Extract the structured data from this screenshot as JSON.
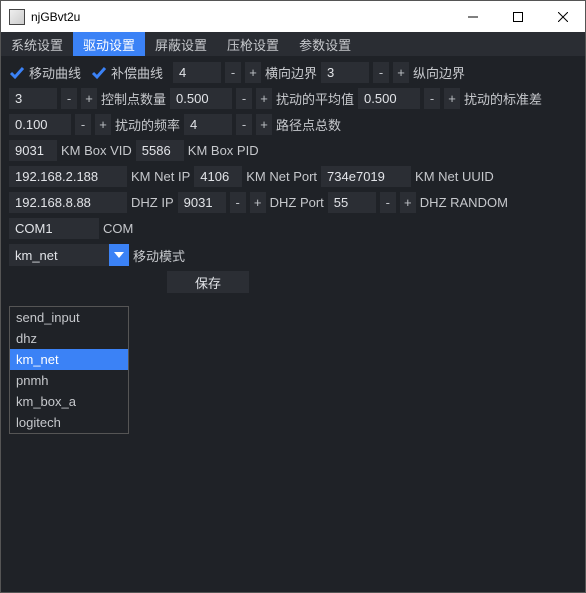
{
  "window": {
    "title": "njGBvt2u",
    "minimize": "–",
    "maximize": "□",
    "close": "×"
  },
  "tabs": {
    "system": "系统设置",
    "driver": "驱动设置",
    "shield": "屏蔽设置",
    "press": "压枪设置",
    "param": "参数设置"
  },
  "checks": {
    "move_curve": "移动曲线",
    "comp_curve": "补偿曲线"
  },
  "labels": {
    "h_border": "横向边界",
    "v_border": "纵向边界",
    "ctrl_points": "控制点数量",
    "perturb_mean": "扰动的平均值",
    "perturb_std": "扰动的标准差",
    "perturb_freq": "扰动的频率",
    "path_total": "路径点总数",
    "km_box_vid": "KM Box VID",
    "km_box_pid": "KM Box PID",
    "km_net_ip": "KM Net IP",
    "km_net_port": "KM Net Port",
    "km_net_uuid": "KM Net UUID",
    "dhz_ip": "DHZ IP",
    "dhz_port": "DHZ Port",
    "dhz_random": "DHZ RANDOM",
    "com": "COM",
    "move_mode": "移动模式",
    "save": "保存"
  },
  "values": {
    "v1": "4",
    "h_border": "3",
    "v_border": "3",
    "ctrl_points": "0.500",
    "perturb_mean": "0.500",
    "perturb_std": "0.100",
    "perturb_freq": "4",
    "km_box_vid": "9031",
    "km_box_vid2": "5586",
    "km_net_ip": "192.168.2.188",
    "km_net_port": "4106",
    "km_net_uuid": "734e7019",
    "dhz_ip": "192.168.8.88",
    "dhz_port": "9031",
    "dhz_random": "55",
    "com": "COM1",
    "move_mode": "km_net"
  },
  "spin": {
    "minus": "-",
    "plus": "+"
  },
  "dropdown": {
    "options": [
      "send_input",
      "dhz",
      "km_net",
      "pnmh",
      "km_box_a",
      "logitech"
    ],
    "selected": "km_net"
  }
}
